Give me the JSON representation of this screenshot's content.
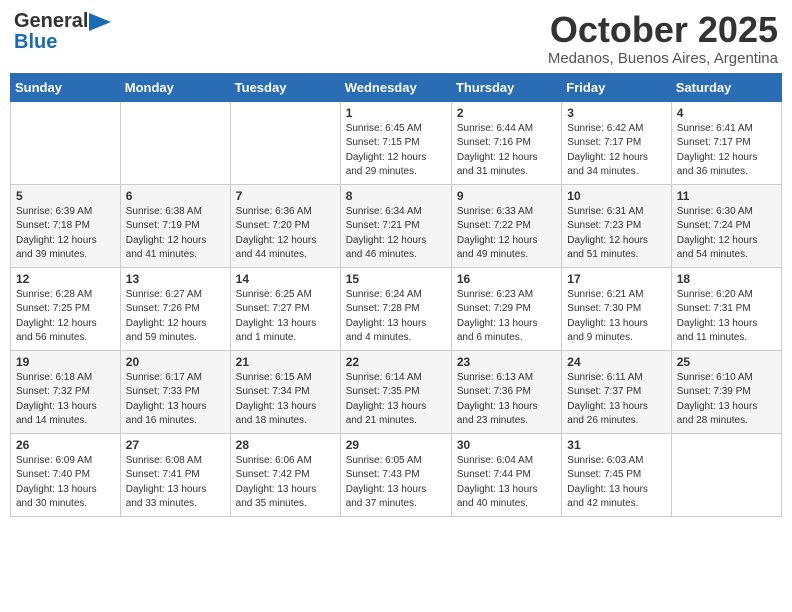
{
  "header": {
    "logo_general": "General",
    "logo_blue": "Blue",
    "month_title": "October 2025",
    "location": "Medanos, Buenos Aires, Argentina"
  },
  "days_of_week": [
    "Sunday",
    "Monday",
    "Tuesday",
    "Wednesday",
    "Thursday",
    "Friday",
    "Saturday"
  ],
  "weeks": [
    [
      {
        "day": "",
        "info": ""
      },
      {
        "day": "",
        "info": ""
      },
      {
        "day": "",
        "info": ""
      },
      {
        "day": "1",
        "info": "Sunrise: 6:45 AM\nSunset: 7:15 PM\nDaylight: 12 hours\nand 29 minutes."
      },
      {
        "day": "2",
        "info": "Sunrise: 6:44 AM\nSunset: 7:16 PM\nDaylight: 12 hours\nand 31 minutes."
      },
      {
        "day": "3",
        "info": "Sunrise: 6:42 AM\nSunset: 7:17 PM\nDaylight: 12 hours\nand 34 minutes."
      },
      {
        "day": "4",
        "info": "Sunrise: 6:41 AM\nSunset: 7:17 PM\nDaylight: 12 hours\nand 36 minutes."
      }
    ],
    [
      {
        "day": "5",
        "info": "Sunrise: 6:39 AM\nSunset: 7:18 PM\nDaylight: 12 hours\nand 39 minutes."
      },
      {
        "day": "6",
        "info": "Sunrise: 6:38 AM\nSunset: 7:19 PM\nDaylight: 12 hours\nand 41 minutes."
      },
      {
        "day": "7",
        "info": "Sunrise: 6:36 AM\nSunset: 7:20 PM\nDaylight: 12 hours\nand 44 minutes."
      },
      {
        "day": "8",
        "info": "Sunrise: 6:34 AM\nSunset: 7:21 PM\nDaylight: 12 hours\nand 46 minutes."
      },
      {
        "day": "9",
        "info": "Sunrise: 6:33 AM\nSunset: 7:22 PM\nDaylight: 12 hours\nand 49 minutes."
      },
      {
        "day": "10",
        "info": "Sunrise: 6:31 AM\nSunset: 7:23 PM\nDaylight: 12 hours\nand 51 minutes."
      },
      {
        "day": "11",
        "info": "Sunrise: 6:30 AM\nSunset: 7:24 PM\nDaylight: 12 hours\nand 54 minutes."
      }
    ],
    [
      {
        "day": "12",
        "info": "Sunrise: 6:28 AM\nSunset: 7:25 PM\nDaylight: 12 hours\nand 56 minutes."
      },
      {
        "day": "13",
        "info": "Sunrise: 6:27 AM\nSunset: 7:26 PM\nDaylight: 12 hours\nand 59 minutes."
      },
      {
        "day": "14",
        "info": "Sunrise: 6:25 AM\nSunset: 7:27 PM\nDaylight: 13 hours\nand 1 minute."
      },
      {
        "day": "15",
        "info": "Sunrise: 6:24 AM\nSunset: 7:28 PM\nDaylight: 13 hours\nand 4 minutes."
      },
      {
        "day": "16",
        "info": "Sunrise: 6:23 AM\nSunset: 7:29 PM\nDaylight: 13 hours\nand 6 minutes."
      },
      {
        "day": "17",
        "info": "Sunrise: 6:21 AM\nSunset: 7:30 PM\nDaylight: 13 hours\nand 9 minutes."
      },
      {
        "day": "18",
        "info": "Sunrise: 6:20 AM\nSunset: 7:31 PM\nDaylight: 13 hours\nand 11 minutes."
      }
    ],
    [
      {
        "day": "19",
        "info": "Sunrise: 6:18 AM\nSunset: 7:32 PM\nDaylight: 13 hours\nand 14 minutes."
      },
      {
        "day": "20",
        "info": "Sunrise: 6:17 AM\nSunset: 7:33 PM\nDaylight: 13 hours\nand 16 minutes."
      },
      {
        "day": "21",
        "info": "Sunrise: 6:15 AM\nSunset: 7:34 PM\nDaylight: 13 hours\nand 18 minutes."
      },
      {
        "day": "22",
        "info": "Sunrise: 6:14 AM\nSunset: 7:35 PM\nDaylight: 13 hours\nand 21 minutes."
      },
      {
        "day": "23",
        "info": "Sunrise: 6:13 AM\nSunset: 7:36 PM\nDaylight: 13 hours\nand 23 minutes."
      },
      {
        "day": "24",
        "info": "Sunrise: 6:11 AM\nSunset: 7:37 PM\nDaylight: 13 hours\nand 26 minutes."
      },
      {
        "day": "25",
        "info": "Sunrise: 6:10 AM\nSunset: 7:39 PM\nDaylight: 13 hours\nand 28 minutes."
      }
    ],
    [
      {
        "day": "26",
        "info": "Sunrise: 6:09 AM\nSunset: 7:40 PM\nDaylight: 13 hours\nand 30 minutes."
      },
      {
        "day": "27",
        "info": "Sunrise: 6:08 AM\nSunset: 7:41 PM\nDaylight: 13 hours\nand 33 minutes."
      },
      {
        "day": "28",
        "info": "Sunrise: 6:06 AM\nSunset: 7:42 PM\nDaylight: 13 hours\nand 35 minutes."
      },
      {
        "day": "29",
        "info": "Sunrise: 6:05 AM\nSunset: 7:43 PM\nDaylight: 13 hours\nand 37 minutes."
      },
      {
        "day": "30",
        "info": "Sunrise: 6:04 AM\nSunset: 7:44 PM\nDaylight: 13 hours\nand 40 minutes."
      },
      {
        "day": "31",
        "info": "Sunrise: 6:03 AM\nSunset: 7:45 PM\nDaylight: 13 hours\nand 42 minutes."
      },
      {
        "day": "",
        "info": ""
      }
    ]
  ]
}
